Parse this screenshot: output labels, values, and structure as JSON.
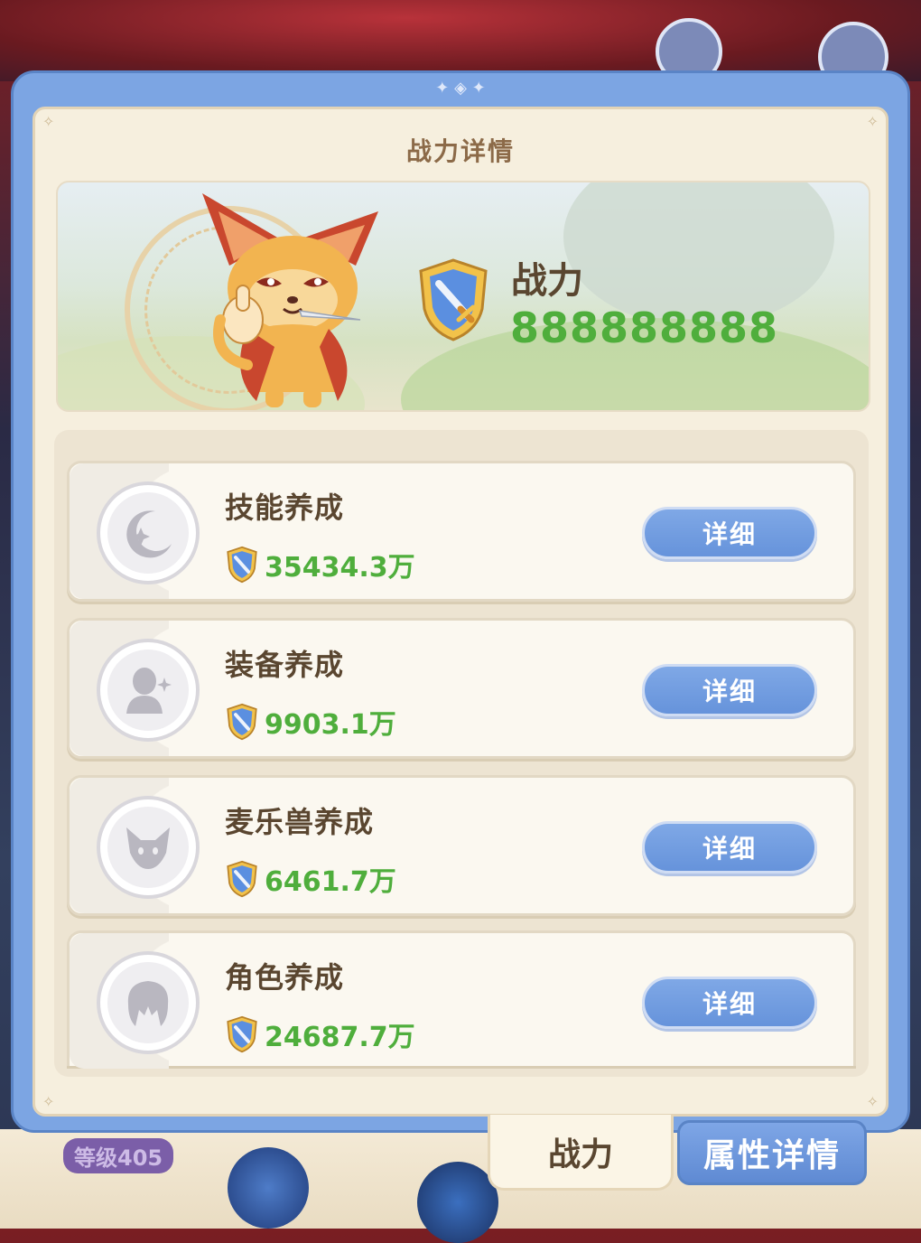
{
  "dialog": {
    "title": "战力详情",
    "power_label": "战力",
    "power_value": "888888888"
  },
  "categories": [
    {
      "name": "技能养成",
      "power": "35434.3万",
      "button": "详细",
      "icon": "moon-star-icon"
    },
    {
      "name": "装备养成",
      "power": "9903.1万",
      "button": "详细",
      "icon": "figure-sparkle-icon"
    },
    {
      "name": "麦乐兽养成",
      "power": "6461.7万",
      "button": "详细",
      "icon": "fox-head-icon"
    },
    {
      "name": "角色养成",
      "power": "24687.7万",
      "button": "详细",
      "icon": "character-hair-icon"
    }
  ],
  "tabs": {
    "power": "战力",
    "attributes": "属性详情"
  },
  "background": {
    "level_badge": "等级405"
  },
  "colors": {
    "frame_blue": "#7ca5e3",
    "panel_cream": "#f6efde",
    "power_green": "#4fae3c",
    "text_brown": "#5a4630"
  }
}
